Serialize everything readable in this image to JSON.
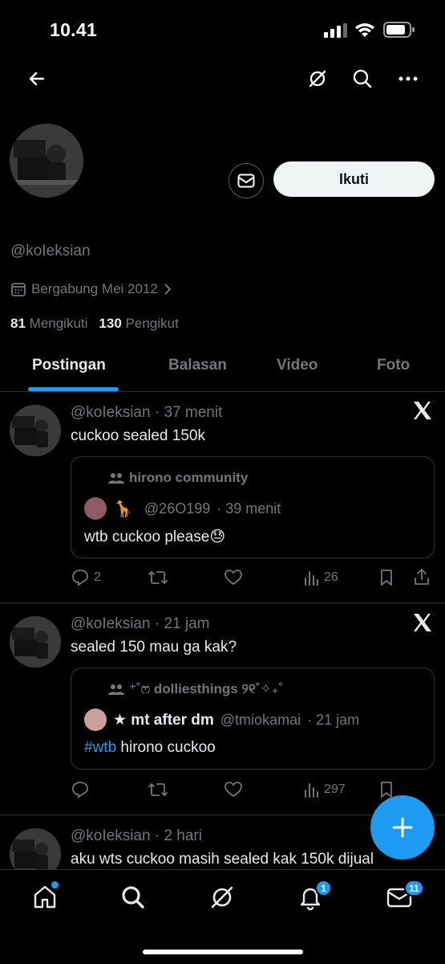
{
  "status": {
    "time": "10.41"
  },
  "profile": {
    "handle": "@koIeksian",
    "joined": "Bergabung Mei 2012",
    "following_count": "81",
    "following_label": "Mengikuti",
    "followers_count": "130",
    "followers_label": "Pengikut",
    "follow_label": "Ikuti"
  },
  "tabs": [
    "Postingan",
    "Balasan",
    "Video",
    "Foto"
  ],
  "posts": [
    {
      "handle": "@koIeksian",
      "time": "· 37 menit",
      "text": "cuckoo sealed 150k",
      "quote": {
        "community": "hirono community",
        "emoji": "🦒",
        "handle": "@26O199",
        "time": "· 39 menit",
        "text": "wtb cuckoo please😓"
      },
      "replies": "2",
      "views": "26"
    },
    {
      "handle": "@koIeksian",
      "time": "· 21 jam",
      "text": "sealed 150 mau ga kak?",
      "quote": {
        "community": "⁺˚ෆ dolliesthings ୨୧˚✧₊˚",
        "name": "★ mt after dm",
        "handle": "@tmiokamai",
        "time": "· 21 jam",
        "hashtag": "#wtb",
        "text": " hirono cuckoo"
      },
      "views": "297"
    },
    {
      "handle": "@koIeksian",
      "time": "· 2 hari",
      "text": "aku wts cuckoo masih sealed kak 150k dijual"
    }
  ],
  "nav": {
    "notif_badge": "1",
    "messages_badge": "11"
  },
  "colors": {
    "accent": "#1d9bf0",
    "background": "#000000"
  }
}
